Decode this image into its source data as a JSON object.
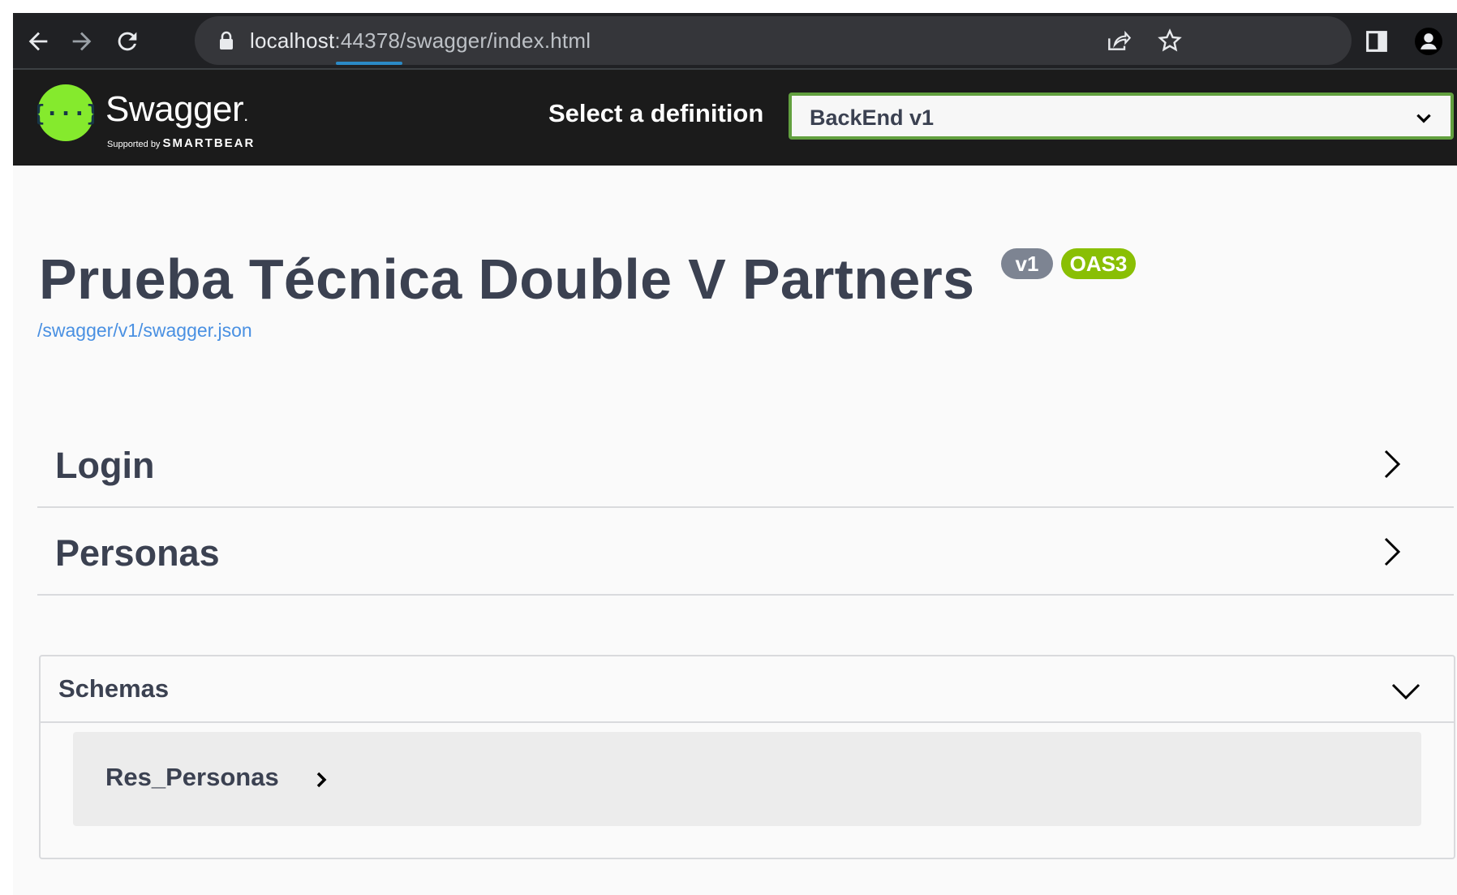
{
  "browser": {
    "url_host": "localhost",
    "url_rest": ":44378/swagger/index.html",
    "icons": [
      "back-arrow-icon",
      "forward-arrow-icon",
      "reload-icon",
      "lock-icon",
      "share-icon",
      "star-icon",
      "side-panel-icon",
      "profile-icon"
    ]
  },
  "topbar": {
    "logo_text": "Swagger",
    "logo_dot": ".",
    "logo_sub_small": "Supported by",
    "logo_sub_brand": "SMARTBEAR",
    "definition_label": "Select a definition",
    "definition_value": "BackEnd v1",
    "accent_color": "#85ea2d"
  },
  "info": {
    "title": "Prueba Técnica Double V Partners",
    "version_badge": "v1",
    "oas_badge": "OAS3",
    "spec_url": "/swagger/v1/swagger.json"
  },
  "tags": [
    {
      "name": "Login"
    },
    {
      "name": "Personas"
    }
  ],
  "schemas": {
    "title": "Schemas",
    "models": [
      {
        "name": "Res_Personas"
      }
    ]
  }
}
